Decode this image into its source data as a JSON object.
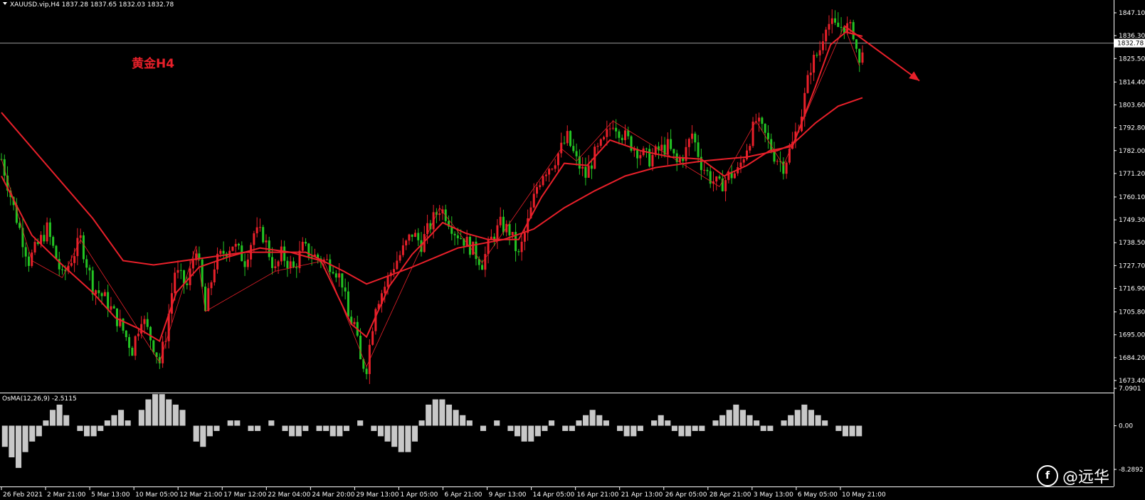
{
  "header": {
    "symbol_text": "XAUUSD.vip,H4  1837.28 1837.65 1832.03 1832.78",
    "caret_icon": "triangle-down-icon"
  },
  "annotation": {
    "label": "黄金H4",
    "color": "#e8202a"
  },
  "price_axis": {
    "ticks": [
      "1847.10",
      "1836.30",
      "1825.50",
      "1814.40",
      "1803.60",
      "1792.80",
      "1782.00",
      "1771.20",
      "1760.10",
      "1749.30",
      "1738.50",
      "1727.70",
      "1716.90",
      "1705.80",
      "1695.00",
      "1684.20",
      "1673.40"
    ],
    "current_price": "1832.78"
  },
  "indicator": {
    "label": "OsMA(12,26,9) -2.5115",
    "ticks": [
      "7.0901",
      "0.00",
      "-8.2892"
    ]
  },
  "time_axis": {
    "labels": [
      "26 Feb 2021",
      "2 Mar 21:00",
      "5 Mar 13:00",
      "10 Mar 05:00",
      "12 Mar 21:00",
      "17 Mar 12:00",
      "22 Mar 04:00",
      "24 Mar 20:00",
      "29 Mar 13:00",
      "1 Apr 05:00",
      "6 Apr 21:00",
      "9 Apr 13:00",
      "14 Apr 05:00",
      "16 Apr 21:00",
      "21 Apr 13:00",
      "26 Apr 05:00",
      "28 Apr 21:00",
      "3 May 13:00",
      "6 May 05:00",
      "10 May 21:00"
    ]
  },
  "watermark": {
    "text": "@远华",
    "icon": "brand-logo-icon"
  },
  "colors": {
    "bull": "#e8202a",
    "bear": "#23c423",
    "ma": "#e8202a",
    "hist": "#c8c8c8",
    "grid": "#808080"
  },
  "chart_data": {
    "type": "candlestick",
    "symbol": "XAUUSD.vip",
    "timeframe": "H4",
    "last_ohlc": {
      "open": 1837.28,
      "high": 1837.65,
      "low": 1832.03,
      "close": 1832.78
    },
    "close_path": [
      [
        0,
        1778
      ],
      [
        8,
        1755
      ],
      [
        18,
        1730
      ],
      [
        30,
        1745
      ],
      [
        40,
        1722
      ],
      [
        52,
        1740
      ],
      [
        60,
        1718
      ],
      [
        68,
        1712
      ],
      [
        78,
        1700
      ],
      [
        86,
        1688
      ],
      [
        92,
        1704
      ],
      [
        100,
        1690
      ],
      [
        104,
        1682
      ],
      [
        108,
        1695
      ],
      [
        114,
        1725
      ],
      [
        122,
        1718
      ],
      [
        128,
        1737
      ],
      [
        134,
        1706
      ],
      [
        140,
        1728
      ],
      [
        146,
        1734
      ],
      [
        152,
        1738
      ],
      [
        160,
        1730
      ],
      [
        166,
        1743
      ],
      [
        172,
        1742
      ],
      [
        180,
        1725
      ],
      [
        184,
        1733
      ],
      [
        192,
        1726
      ],
      [
        198,
        1736
      ],
      [
        206,
        1732
      ],
      [
        212,
        1730
      ],
      [
        218,
        1728
      ],
      [
        224,
        1720
      ],
      [
        228,
        1703
      ],
      [
        232,
        1700
      ],
      [
        236,
        1682
      ],
      [
        240,
        1680
      ],
      [
        246,
        1710
      ],
      [
        252,
        1718
      ],
      [
        258,
        1728
      ],
      [
        264,
        1735
      ],
      [
        270,
        1743
      ],
      [
        276,
        1738
      ],
      [
        282,
        1747
      ],
      [
        288,
        1755
      ],
      [
        292,
        1752
      ],
      [
        298,
        1744
      ],
      [
        304,
        1740
      ],
      [
        310,
        1735
      ],
      [
        316,
        1729
      ],
      [
        322,
        1740
      ],
      [
        328,
        1747
      ],
      [
        334,
        1744
      ],
      [
        340,
        1732
      ],
      [
        346,
        1748
      ],
      [
        352,
        1765
      ],
      [
        356,
        1772
      ],
      [
        362,
        1776
      ],
      [
        368,
        1783
      ],
      [
        372,
        1788
      ],
      [
        378,
        1777
      ],
      [
        384,
        1770
      ],
      [
        390,
        1780
      ],
      [
        396,
        1786
      ],
      [
        402,
        1796
      ],
      [
        408,
        1790
      ],
      [
        414,
        1785
      ],
      [
        420,
        1781
      ],
      [
        426,
        1778
      ],
      [
        432,
        1782
      ],
      [
        438,
        1784
      ],
      [
        444,
        1776
      ],
      [
        450,
        1782
      ],
      [
        454,
        1790
      ],
      [
        460,
        1776
      ],
      [
        466,
        1769
      ],
      [
        472,
        1765
      ],
      [
        478,
        1770
      ],
      [
        484,
        1772
      ],
      [
        490,
        1784
      ],
      [
        496,
        1796
      ],
      [
        502,
        1789
      ],
      [
        508,
        1780
      ],
      [
        514,
        1775
      ],
      [
        520,
        1785
      ],
      [
        526,
        1800
      ],
      [
        532,
        1822
      ],
      [
        538,
        1830
      ],
      [
        542,
        1843
      ],
      [
        548,
        1840
      ],
      [
        554,
        1841
      ],
      [
        560,
        1838
      ],
      [
        564,
        1822
      ],
      [
        566,
        1832
      ]
    ],
    "ma_short_path": [
      [
        0,
        1770
      ],
      [
        20,
        1742
      ],
      [
        40,
        1728
      ],
      [
        60,
        1715
      ],
      [
        75,
        1703
      ],
      [
        90,
        1698
      ],
      [
        104,
        1692
      ],
      [
        115,
        1715
      ],
      [
        130,
        1727
      ],
      [
        150,
        1732
      ],
      [
        170,
        1736
      ],
      [
        190,
        1734
      ],
      [
        210,
        1730
      ],
      [
        230,
        1700
      ],
      [
        240,
        1694
      ],
      [
        255,
        1718
      ],
      [
        270,
        1733
      ],
      [
        290,
        1748
      ],
      [
        305,
        1743
      ],
      [
        320,
        1740
      ],
      [
        340,
        1740
      ],
      [
        355,
        1760
      ],
      [
        370,
        1776
      ],
      [
        385,
        1775
      ],
      [
        400,
        1787
      ],
      [
        420,
        1782
      ],
      [
        440,
        1779
      ],
      [
        460,
        1778
      ],
      [
        475,
        1770
      ],
      [
        490,
        1775
      ],
      [
        505,
        1782
      ],
      [
        520,
        1784
      ],
      [
        535,
        1812
      ],
      [
        545,
        1832
      ],
      [
        555,
        1838
      ],
      [
        566,
        1836
      ]
    ],
    "ma_long_path": [
      [
        0,
        1800
      ],
      [
        30,
        1775
      ],
      [
        60,
        1750
      ],
      [
        80,
        1730
      ],
      [
        100,
        1728
      ],
      [
        130,
        1731
      ],
      [
        160,
        1734
      ],
      [
        200,
        1734
      ],
      [
        225,
        1725
      ],
      [
        240,
        1719
      ],
      [
        270,
        1727
      ],
      [
        300,
        1736
      ],
      [
        330,
        1740
      ],
      [
        350,
        1745
      ],
      [
        370,
        1755
      ],
      [
        390,
        1763
      ],
      [
        410,
        1770
      ],
      [
        430,
        1774
      ],
      [
        460,
        1777
      ],
      [
        490,
        1779
      ],
      [
        510,
        1782
      ],
      [
        520,
        1785
      ],
      [
        535,
        1795
      ],
      [
        550,
        1803
      ],
      [
        566,
        1807
      ]
    ],
    "zigzag_path": [
      [
        0,
        1778
      ],
      [
        20,
        1730
      ],
      [
        40,
        1722
      ],
      [
        52,
        1740
      ],
      [
        104,
        1682
      ],
      [
        128,
        1737
      ],
      [
        134,
        1706
      ],
      [
        180,
        1725
      ],
      [
        212,
        1730
      ],
      [
        240,
        1680
      ],
      [
        288,
        1755
      ],
      [
        316,
        1729
      ],
      [
        368,
        1783
      ],
      [
        378,
        1777
      ],
      [
        402,
        1796
      ],
      [
        472,
        1765
      ],
      [
        496,
        1796
      ],
      [
        514,
        1775
      ],
      [
        554,
        1841
      ],
      [
        564,
        1822
      ]
    ],
    "forecast_arrow": {
      "from_price": 1841,
      "to_price": 1815
    },
    "osma_values": [
      -4,
      -6,
      -8,
      -5,
      -3,
      -2,
      1,
      3,
      4,
      2,
      0,
      -1,
      -2,
      -2,
      -1,
      1,
      2,
      3,
      1,
      0,
      3,
      5,
      6,
      6,
      5,
      4,
      3,
      0,
      -3,
      -4,
      -2,
      -1,
      0,
      1,
      1,
      0,
      -1,
      -1,
      0,
      1,
      0,
      -1,
      -2,
      -2,
      -1,
      0,
      -1,
      -1,
      -2,
      -2,
      -1,
      0,
      1,
      0,
      -1,
      -2,
      -3,
      -4,
      -5,
      -5,
      -3,
      1,
      4,
      5,
      5,
      4,
      3,
      2,
      1,
      0,
      -1,
      0,
      1,
      0,
      -1,
      -2,
      -3,
      -3,
      -2,
      -1,
      1,
      0,
      -1,
      -1,
      1,
      2,
      3,
      2,
      1,
      0,
      -1,
      -2,
      -2,
      -1,
      0,
      1,
      2,
      1,
      -1,
      -2,
      -2,
      -1,
      -1,
      0,
      1,
      2,
      3,
      4,
      3,
      2,
      1,
      -1,
      -1,
      0,
      1,
      2,
      3,
      4,
      3,
      2,
      1,
      0,
      -1,
      -2,
      -2,
      -2
    ]
  }
}
